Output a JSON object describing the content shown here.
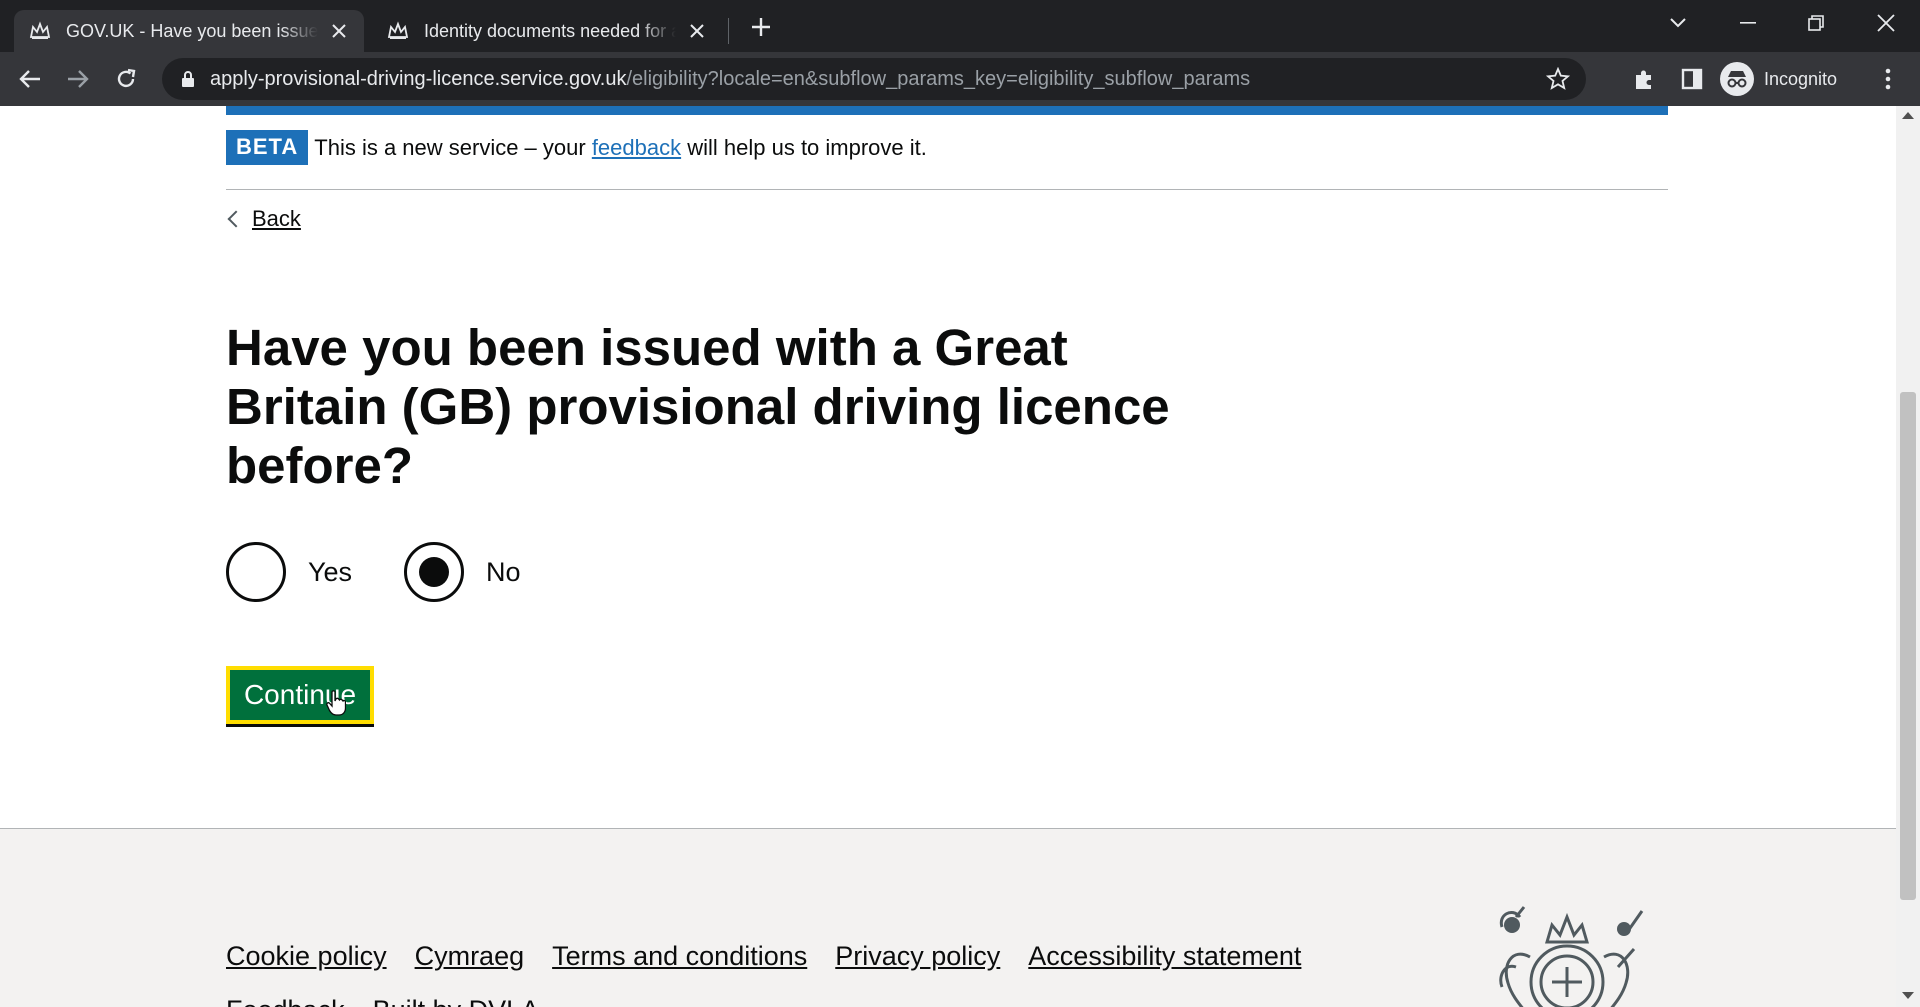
{
  "browser": {
    "tabs": [
      {
        "title": "GOV.UK - Have you been issued with a Great Britain",
        "active": true
      },
      {
        "title": "Identity documents needed for a driving licence",
        "active": false
      }
    ],
    "url_host": "apply-provisional-driving-licence.service.gov.uk",
    "url_rest": "/eligibility?locale=en&subflow_params_key=eligibility_subflow_params",
    "profile_label": "Incognito"
  },
  "banner": {
    "tag": "BETA",
    "text_before": "This is a new service – your ",
    "link": "feedback",
    "text_after": " will help us to improve it."
  },
  "back_link": "Back",
  "question": {
    "heading": "Have you been issued with a Great Britain (GB) provisional driving licence before?",
    "options": [
      {
        "label": "Yes",
        "selected": false
      },
      {
        "label": "No",
        "selected": true
      }
    ]
  },
  "continue_label": "Continue",
  "footer": {
    "links": [
      "Cookie policy",
      "Cymraeg",
      "Terms and conditions",
      "Privacy policy",
      "Accessibility statement"
    ],
    "links_row2": [
      "Feedback",
      "Built by DVLA"
    ]
  },
  "colors": {
    "govuk_blue": "#1d70b8",
    "button_green": "#00703c",
    "focus_yellow": "#ffdd00"
  }
}
